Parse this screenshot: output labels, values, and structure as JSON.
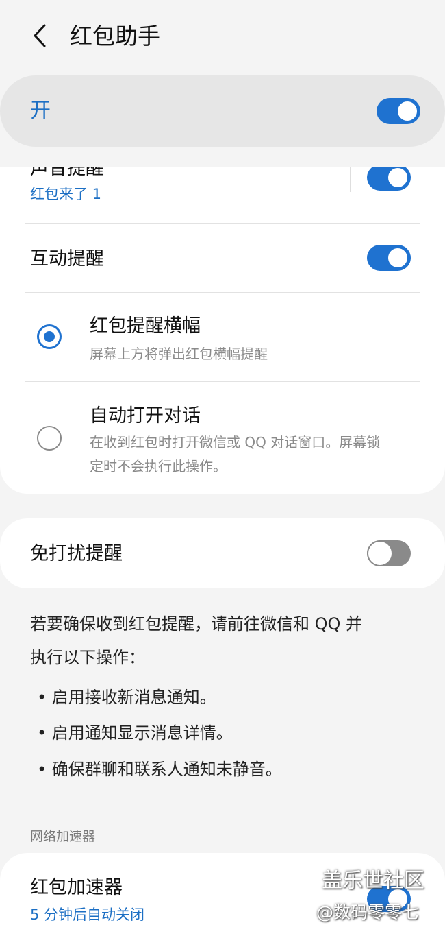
{
  "header": {
    "title": "红包助手"
  },
  "master": {
    "label": "开",
    "enabled": true
  },
  "sound_reminder": {
    "title": "声音提醒",
    "subtitle": "红包来了 1",
    "enabled": true
  },
  "interactive_reminder": {
    "title": "互动提醒",
    "enabled": true
  },
  "options": [
    {
      "title": "红包提醒横幅",
      "desc_lines": [
        "屏幕上方将弹出红包横幅提醒"
      ],
      "selected": true
    },
    {
      "title": "自动打开对话",
      "desc_lines": [
        "在收到红包时打开微信或 QQ 对话窗口。屏幕锁",
        "定时不会执行此操作。"
      ],
      "selected": false
    }
  ],
  "dnd_reminder": {
    "title": "免打扰提醒",
    "enabled": false
  },
  "info": {
    "lines": [
      "若要确保收到红包提醒，请前往微信和 QQ 并",
      "执行以下操作："
    ],
    "bullets": [
      "• 启用接收新消息通知。",
      "• 启用通知显示消息详情。",
      "• 确保群聊和联系人通知未静音。"
    ]
  },
  "network_section": {
    "header": "网络加速器"
  },
  "accelerator": {
    "title": "红包加速器",
    "subtitle": "5 分钟后自动关闭",
    "enabled": true
  },
  "watermark": {
    "line1": "盖乐世社区",
    "line2": "@数码零零七"
  },
  "colors": {
    "accent": "#1f72d0",
    "background": "#f4f4f4",
    "card": "#ffffff"
  },
  "icons": {
    "back": "chevron-left-icon"
  }
}
